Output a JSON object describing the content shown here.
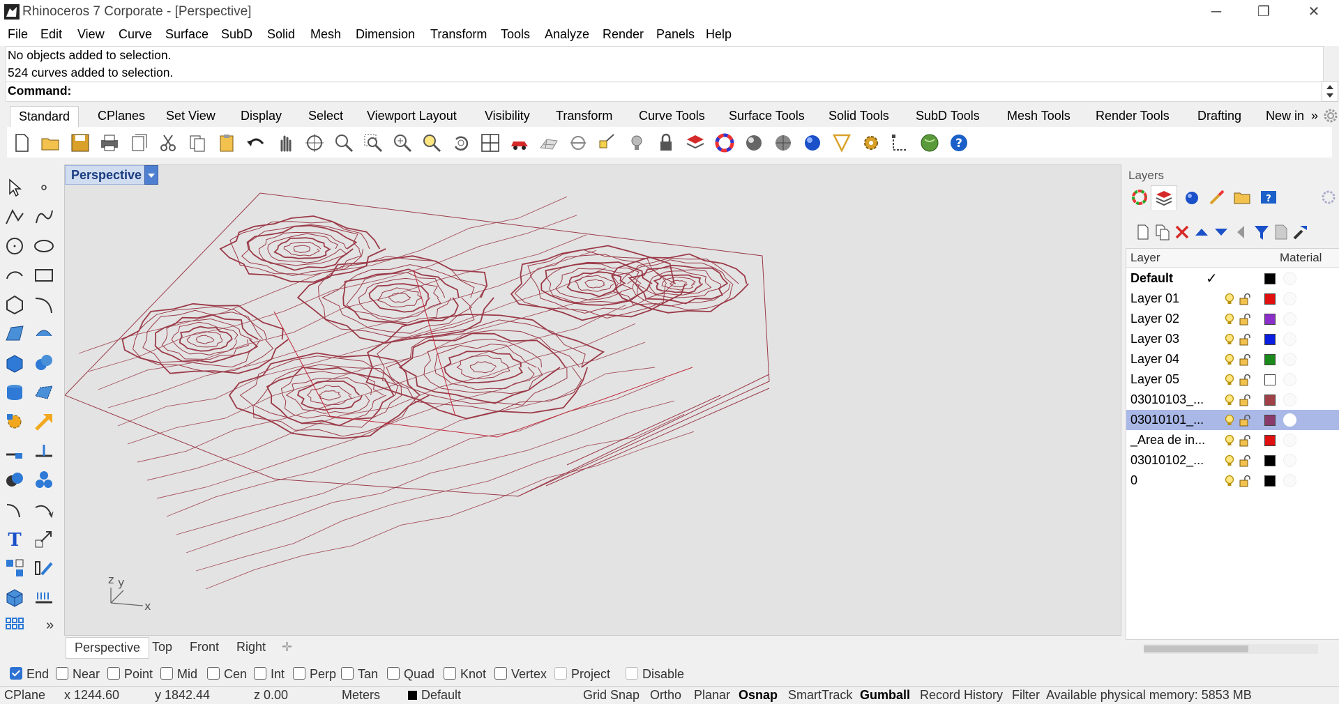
{
  "window": {
    "title": "Rhinoceros 7 Corporate - [Perspective]",
    "controls": {
      "minimize": "─",
      "restore": "❐",
      "close": "✕"
    }
  },
  "menu": [
    "File",
    "Edit",
    "View",
    "Curve",
    "Surface",
    "SubD",
    "Solid",
    "Mesh",
    "Dimension",
    "Transform",
    "Tools",
    "Analyze",
    "Render",
    "Panels",
    "Help"
  ],
  "command": {
    "history": [
      "No objects added to selection.",
      "524 curves added to selection."
    ],
    "prompt": "Command:"
  },
  "toolbar_tabs": [
    "Standard",
    "CPlanes",
    "Set View",
    "Display",
    "Select",
    "Viewport Layout",
    "Visibility",
    "Transform",
    "Curve Tools",
    "Surface Tools",
    "Solid Tools",
    "SubD Tools",
    "Mesh Tools",
    "Render Tools",
    "Drafting",
    "New in"
  ],
  "toolbar_tabs_overflow": "»",
  "toolbar_icons": [
    "new-file",
    "open-file",
    "save",
    "print",
    "import",
    "cut",
    "copy",
    "paste",
    "undo",
    "pan",
    "rotate-view",
    "zoom",
    "zoom-window",
    "zoom-extents",
    "zoom-selected",
    "rotate",
    "four-viewports",
    "car",
    "hide-grid",
    "named-cplane",
    "osnap",
    "light",
    "lock",
    "layer",
    "color-wheel",
    "shade-sphere",
    "render-sphere",
    "rendered-sphere",
    "draft-angle",
    "settings-gear",
    "dimension",
    "globe",
    "help"
  ],
  "left_tools": [
    "select-arrow",
    "point",
    "polyline",
    "curve",
    "circle",
    "ellipse",
    "arc",
    "rectangle",
    "polygon",
    "arc-tool",
    "surface-edge",
    "surface-rotate",
    "box-solid",
    "spheres",
    "cylinder",
    "tweak-surface",
    "explode",
    "gumball-arrow",
    "group",
    "ungroup",
    "boolean",
    "boolean-split",
    "fillet",
    "blend",
    "text",
    "scale-tool",
    "array",
    "orient",
    "mesh-box",
    "hatch",
    "grid-array",
    "more"
  ],
  "left_tools_more": "»",
  "viewport": {
    "name": "Perspective",
    "axis_labels": {
      "z": "z",
      "y": "y",
      "x": "x"
    },
    "terrain_color": "#9b3a48",
    "boundary_color": "#c0283a"
  },
  "viewport_tabs": [
    "Perspective",
    "Top",
    "Front",
    "Right"
  ],
  "viewport_add": "✛",
  "osnaps": [
    {
      "label": "End",
      "checked": true
    },
    {
      "label": "Near",
      "checked": false
    },
    {
      "label": "Point",
      "checked": false
    },
    {
      "label": "Mid",
      "checked": false
    },
    {
      "label": "Cen",
      "checked": false
    },
    {
      "label": "Int",
      "checked": false
    },
    {
      "label": "Perp",
      "checked": false
    },
    {
      "label": "Tan",
      "checked": false
    },
    {
      "label": "Quad",
      "checked": false
    },
    {
      "label": "Knot",
      "checked": false
    },
    {
      "label": "Vertex",
      "checked": false
    },
    {
      "label": "Project",
      "checked": false
    },
    {
      "label": "Disable",
      "checked": false
    }
  ],
  "status": {
    "cplane": "CPlane",
    "x": "x 1244.60",
    "y": "y 1842.44",
    "z": "z 0.00",
    "units": "Meters",
    "layer": "Default",
    "grid_snap": "Grid Snap",
    "ortho": "Ortho",
    "planar": "Planar",
    "osnap": "Osnap",
    "smarttrack": "SmartTrack",
    "gumball": "Gumball",
    "record_history": "Record History",
    "filter": "Filter",
    "memory": "Available physical memory: 5853 MB"
  },
  "layers_panel": {
    "title": "Layers",
    "col_layer": "Layer",
    "col_material": "Material",
    "panel_tab_icons": [
      "color-wheel-icon",
      "layers-icon",
      "render-icon",
      "paint-icon",
      "folder-icon",
      "help-icon",
      "gear-icon"
    ],
    "tool_icons": [
      "new-layer-icon",
      "new-sublayer-icon",
      "delete-icon",
      "move-up-icon",
      "move-down-icon",
      "move-left-icon",
      "filter-icon",
      "page-icon",
      "tools-icon"
    ],
    "current_check": "✓",
    "layers": [
      {
        "name": "Default",
        "color": "#000000",
        "current": true,
        "selected": false
      },
      {
        "name": "Layer 01",
        "color": "#e01010",
        "current": false,
        "selected": false
      },
      {
        "name": "Layer 02",
        "color": "#8b2fc9",
        "current": false,
        "selected": false
      },
      {
        "name": "Layer 03",
        "color": "#0a1fe0",
        "current": false,
        "selected": false
      },
      {
        "name": "Layer 04",
        "color": "#1a8a1a",
        "current": false,
        "selected": false
      },
      {
        "name": "Layer 05",
        "color": "#ffffff",
        "current": false,
        "selected": false
      },
      {
        "name": "03010103_...",
        "color": "#a04048",
        "current": false,
        "selected": false
      },
      {
        "name": "03010101_...",
        "color": "#8a3a6a",
        "current": false,
        "selected": true
      },
      {
        "name": "_Area de in...",
        "color": "#e01010",
        "current": false,
        "selected": false
      },
      {
        "name": "03010102_...",
        "color": "#000000",
        "current": false,
        "selected": false
      },
      {
        "name": "0",
        "color": "#000000",
        "current": false,
        "selected": false
      }
    ]
  }
}
